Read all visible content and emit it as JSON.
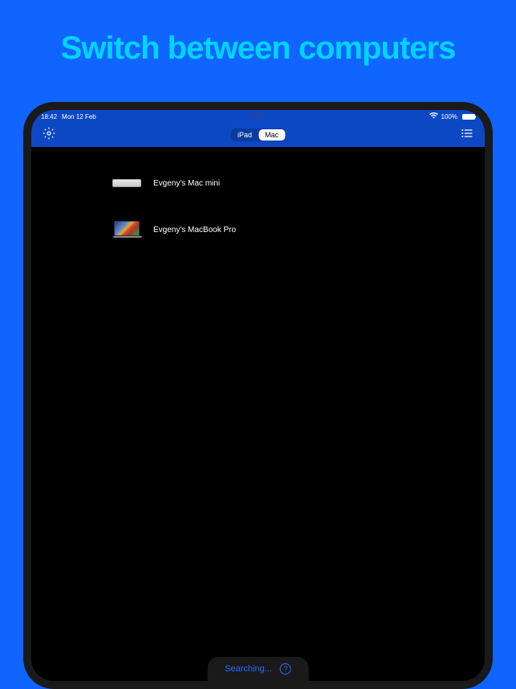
{
  "promo": {
    "title": "Switch between computers"
  },
  "status_bar": {
    "time": "18:42",
    "date": "Mon 12 Feb",
    "battery_percent": "100%"
  },
  "header": {
    "segments": [
      "iPad",
      "Mac"
    ],
    "active_segment": "Mac"
  },
  "devices": [
    {
      "name": "Evgeny's Mac mini",
      "type": "mac-mini"
    },
    {
      "name": "Evgeny's MacBook Pro",
      "type": "macbook"
    }
  ],
  "footer": {
    "status": "Searching..."
  }
}
